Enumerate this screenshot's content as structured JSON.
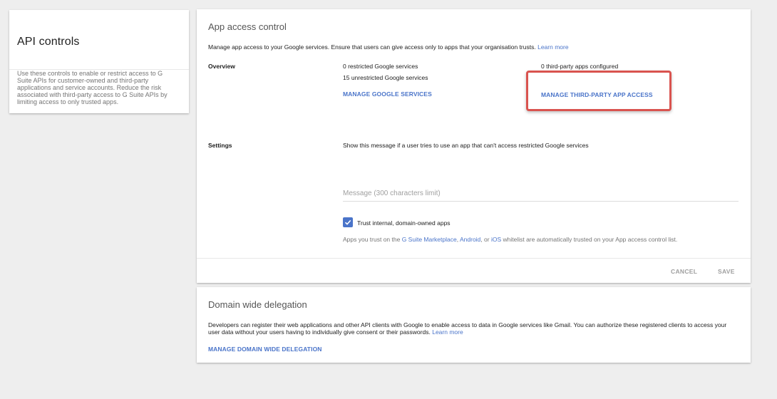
{
  "side": {
    "title": "API controls",
    "description": "Use these controls to enable or restrict access to G Suite APIs for customer-owned and third-party applications and service accounts. Reduce the risk associated with third-party access to G Suite APIs by limiting access to only trusted apps."
  },
  "app_access": {
    "title": "App access control",
    "intro": "Manage app access to your Google services. Ensure that users can give access only to apps that your organisation trusts.",
    "learn_more": "Learn more",
    "overview_label": "Overview",
    "restricted": "0 restricted Google services",
    "unrestricted": "15 unrestricted Google services",
    "manage_google": "MANAGE GOOGLE SERVICES",
    "third_party_count": "0 third-party apps configured",
    "manage_third_party": "MANAGE THIRD-PARTY APP ACCESS",
    "settings_label": "Settings",
    "settings_message": "Show this message if a user tries to use an app that can't access restricted Google services",
    "message_placeholder": "Message (300 characters limit)",
    "trust_label": "Trust internal, domain-owned apps",
    "trust_checked": true,
    "trust_note_prefix": "Apps you trust on the ",
    "trust_link_marketplace": "G Suite Marketplace",
    "trust_sep1": ", ",
    "trust_link_android": "Android",
    "trust_sep2": ", or ",
    "trust_link_ios": "iOS",
    "trust_note_suffix": " whitelist are automatically trusted on your App access control list.",
    "cancel": "CANCEL",
    "save": "SAVE"
  },
  "delegation": {
    "title": "Domain wide delegation",
    "paragraph": "Developers can register their web applications and other API clients with Google to enable access to data in Google services like Gmail. You can authorize these registered clients to access your user data without your users having to individually give consent or their passwords.",
    "learn_more": "Learn more",
    "manage": "MANAGE DOMAIN WIDE DELEGATION"
  },
  "colors": {
    "accent": "#4a74c9",
    "highlight": "#d9534f",
    "background": "#eeeeee"
  }
}
